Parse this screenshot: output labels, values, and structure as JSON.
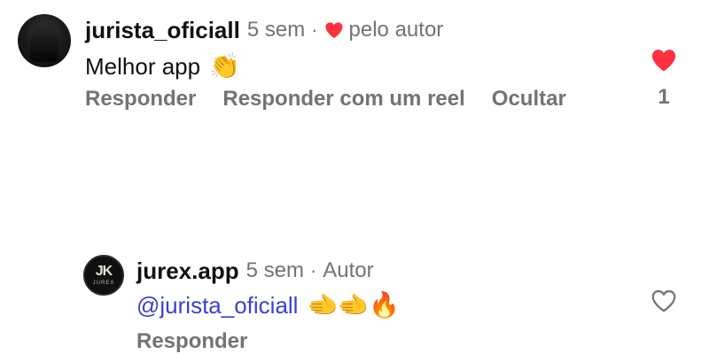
{
  "colors": {
    "like_red": "#ff3040",
    "mention_blue": "#3b3fcf",
    "secondary_gray": "#737373"
  },
  "comment1": {
    "username": "jurista_oficiall",
    "time": "5 sem",
    "separator": "·",
    "liked_by_author": "pelo autor",
    "text": "Melhor app",
    "emoji": "👏",
    "actions": [
      "Responder",
      "Responder com um reel",
      "Ocultar"
    ],
    "like_count": "1",
    "liked": true,
    "icons": [
      "heart-filled-icon"
    ]
  },
  "comment2": {
    "username": "jurex.app",
    "time": "5 sem",
    "separator": "·",
    "role": "Autor",
    "mention": "@jurista_oficiall",
    "emojis": "🫲🫲🔥",
    "actions": [
      "Responder"
    ],
    "liked": false,
    "avatar_text": "JK",
    "avatar_subtext": "JUREX",
    "icons": [
      "heart-outline-icon"
    ]
  }
}
